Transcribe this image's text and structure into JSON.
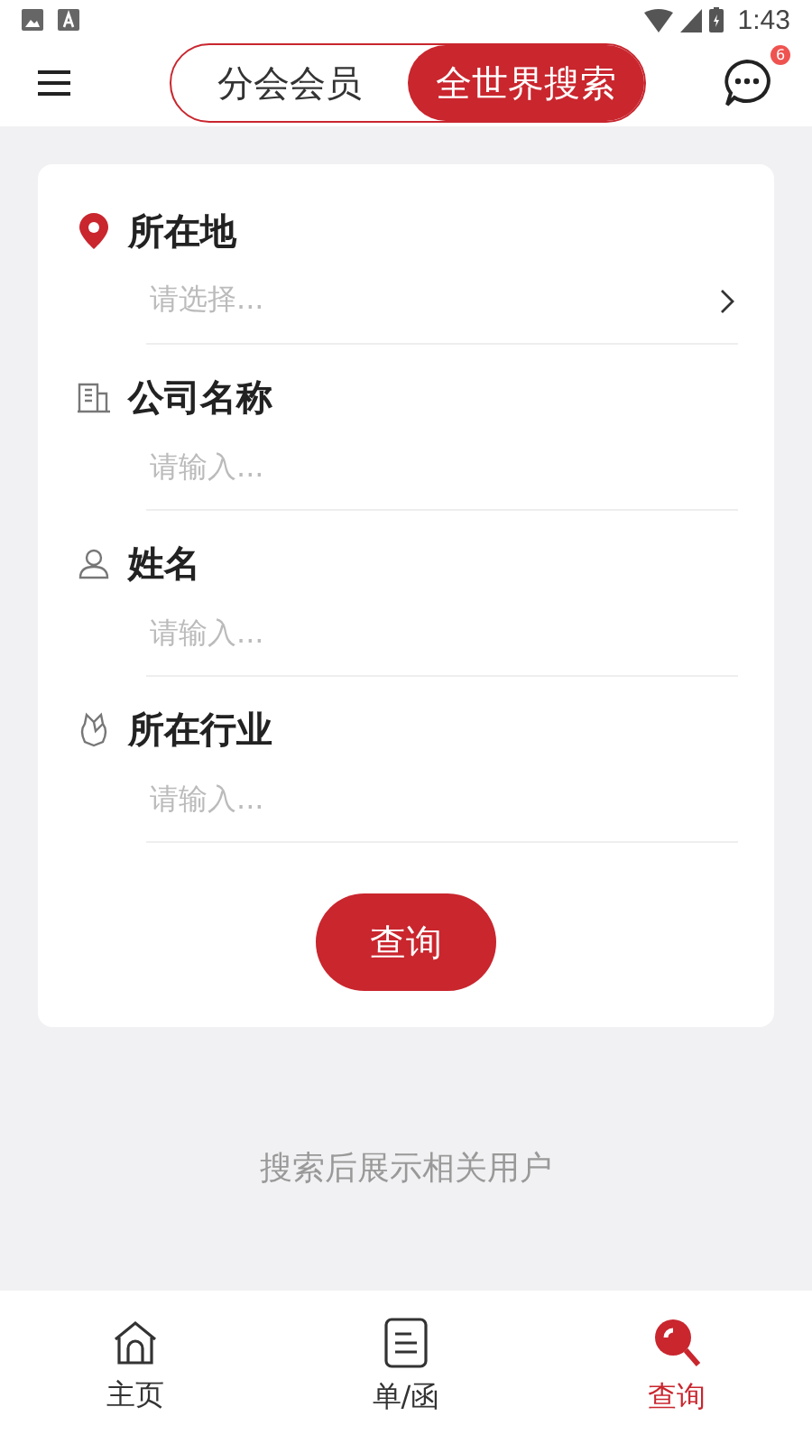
{
  "status_bar": {
    "time": "1:43"
  },
  "header": {
    "badge": "6",
    "segments": [
      {
        "label": "分会会员",
        "selected": false
      },
      {
        "label": "全世界搜索",
        "selected": true
      }
    ]
  },
  "form": {
    "fields": [
      {
        "kind": "select",
        "label": "所在地",
        "placeholder": "请选择..."
      },
      {
        "kind": "input",
        "label": "公司名称",
        "placeholder": "请输入..."
      },
      {
        "kind": "input",
        "label": "姓名",
        "placeholder": "请输入..."
      },
      {
        "kind": "input",
        "label": "所在行业",
        "placeholder": "请输入..."
      }
    ],
    "submit": "查询"
  },
  "hint": "搜索后展示相关用户",
  "bottom_nav": [
    {
      "label": "主页",
      "selected": false
    },
    {
      "label": "单/函",
      "selected": false
    },
    {
      "label": "查询",
      "selected": true
    }
  ]
}
